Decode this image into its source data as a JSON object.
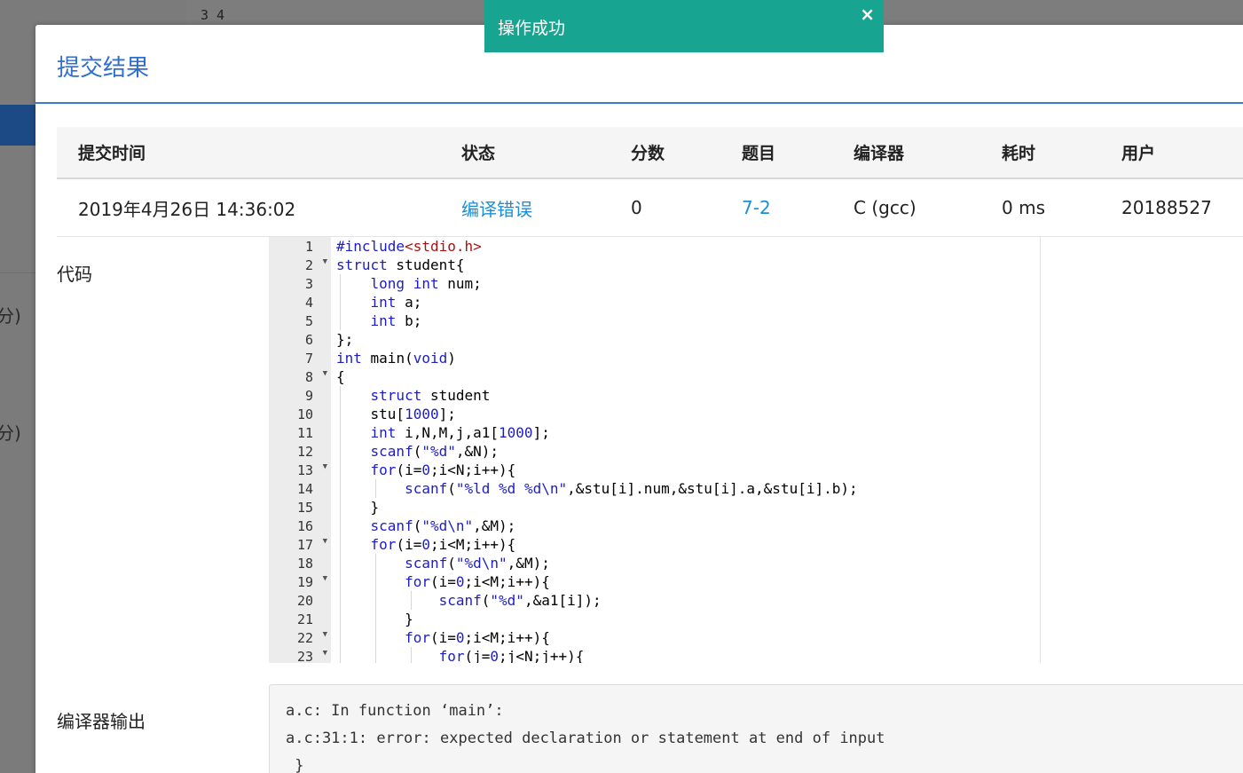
{
  "background": {
    "code_fragment": "3 4",
    "side_text_1": "分)",
    "side_text_2": "分)"
  },
  "toast": {
    "message": "操作成功",
    "close_glyph": "×"
  },
  "modal": {
    "title": "提交结果"
  },
  "table": {
    "headers": [
      "提交时间",
      "状态",
      "分数",
      "题目",
      "编译器",
      "耗时",
      "用户"
    ],
    "row": {
      "time": "2019年4月26日 14:36:02",
      "status": "编译错误",
      "score": "0",
      "problem": "7-2",
      "compiler": "C (gcc)",
      "elapsed": "0 ms",
      "user": "20188527"
    }
  },
  "code": {
    "label": "代码",
    "lines": [
      "#include<stdio.h>",
      "struct student{",
      "    long int num;",
      "    int a;",
      "    int b;",
      "};",
      "int main(void)",
      "{",
      "    struct student",
      "    stu[1000];",
      "    int i,N,M,j,a1[1000];",
      "    scanf(\"%d\",&N);",
      "    for(i=0;i<N;i++){",
      "        scanf(\"%ld %d %d\\n\",&stu[i].num,&stu[i].a,&stu[i].b);",
      "    }",
      "    scanf(\"%d\\n\",&M);",
      "    for(i=0;i<M;i++){",
      "        scanf(\"%d\\n\",&M);",
      "        for(i=0;i<M;i++){",
      "            scanf(\"%d\",&a1[i]);",
      "        }",
      "        for(i=0;i<M;i++){",
      "            for(j=0;j<N;j++){"
    ],
    "fold_lines": [
      2,
      8,
      13,
      17,
      19,
      22,
      23
    ]
  },
  "compiler_output": {
    "label": "编译器输出",
    "lines": [
      "a.c: In function ‘main’:",
      "a.c:31:1: error: expected declaration or statement at end of input",
      " }"
    ]
  },
  "colors": {
    "accent": "#2f6fd0",
    "link": "#1a8fd6",
    "toast_bg": "#17a592",
    "keyword": "#1d1dc8",
    "include": "#a31515"
  }
}
